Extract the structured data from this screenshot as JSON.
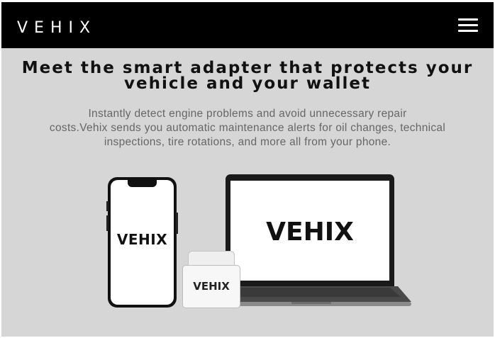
{
  "header": {
    "logo": "VEHIX",
    "menu_icon": "hamburger-menu-icon"
  },
  "hero": {
    "headline_line1": "Meet the smart adapter that protects your",
    "headline_line2": "vehicle and your wallet",
    "subtext_line1": "Instantly detect engine problems and avoid unnecessary repair",
    "subtext_line2": "costs.Vehix sends you automatic maintenance alerts for oil changes, technical",
    "subtext_line3": "inspections, tire rotations, and more all from your phone."
  },
  "devices": {
    "phone_label": "VEHIX",
    "laptop_label": "VEHIX",
    "adapter_label": "VEHIX"
  },
  "colors": {
    "header_bg": "#000000",
    "page_bg": "#d6d6d6",
    "headline": "#111111",
    "subtext": "#666666"
  }
}
